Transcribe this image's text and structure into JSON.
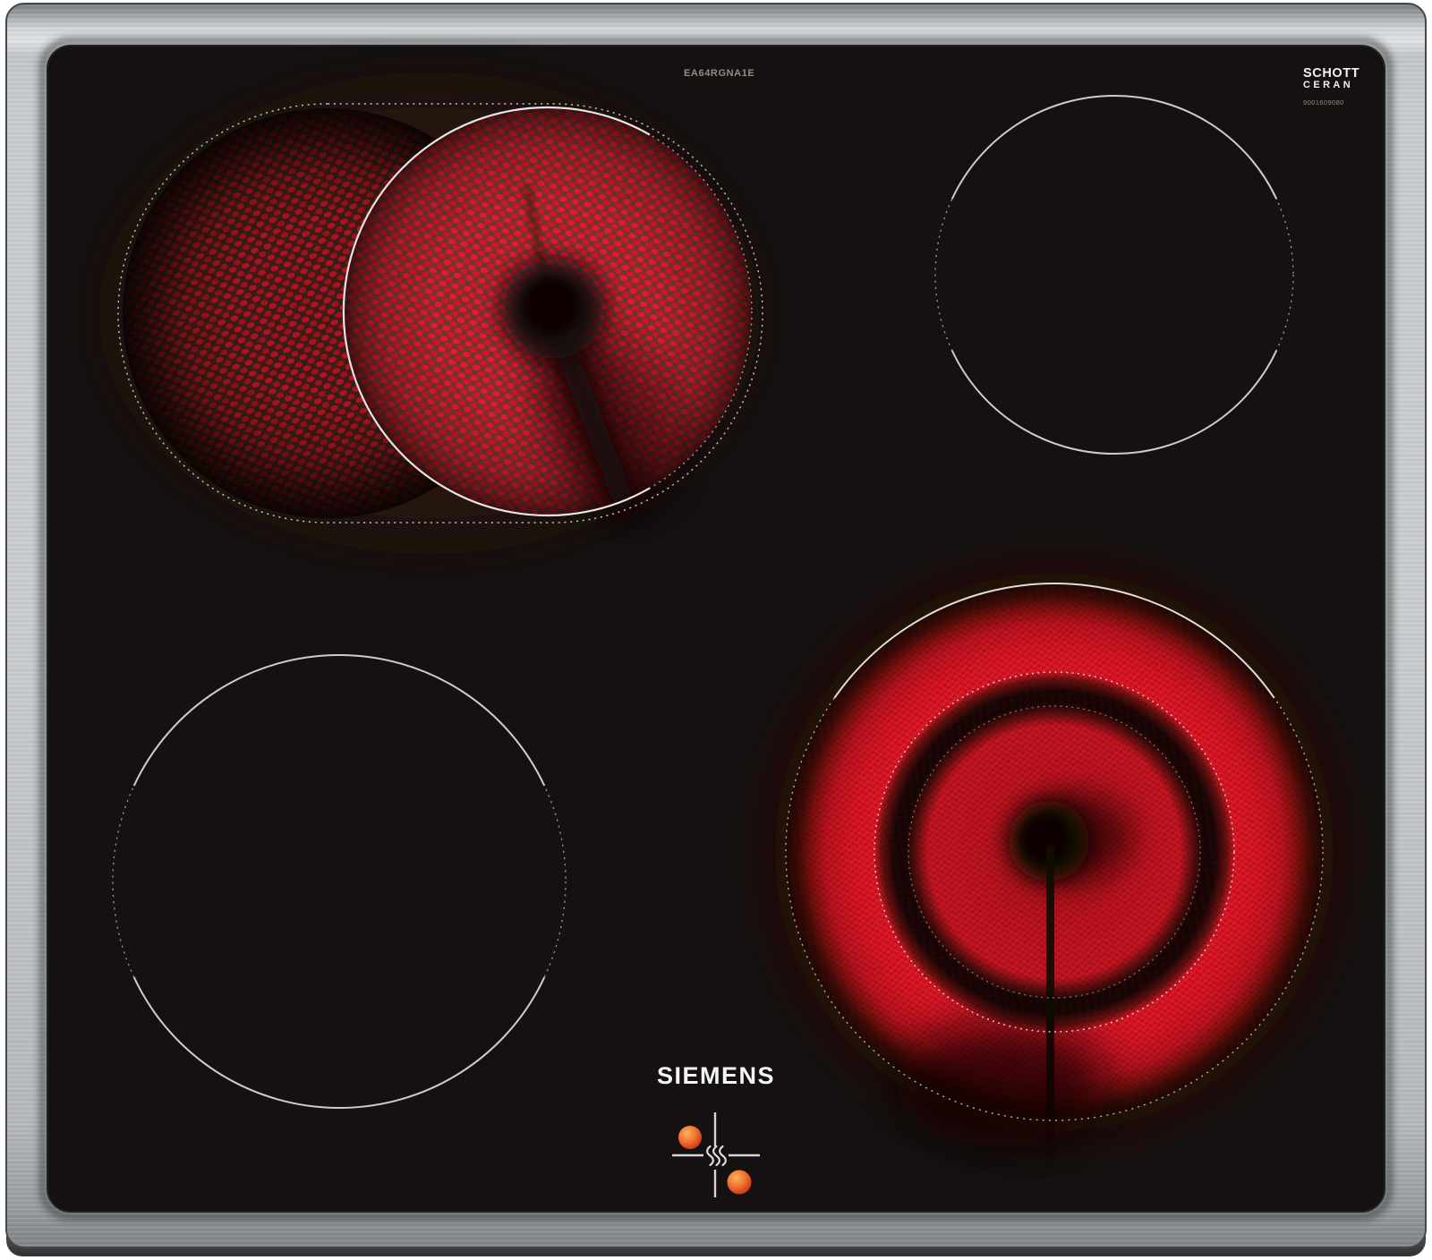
{
  "product": {
    "brand": "SIEMENS",
    "model_number": "EA64RGNA1E",
    "glass_brand_line1": "SCHOTT",
    "glass_brand_line2": "CERAN",
    "serial_number": "9001609080"
  },
  "zones": [
    {
      "position": "back-left",
      "type": "extendable-roaster-zone",
      "state": "on"
    },
    {
      "position": "back-right",
      "type": "single-zone",
      "state": "off"
    },
    {
      "position": "front-left",
      "type": "single-zone",
      "state": "off"
    },
    {
      "position": "front-right",
      "type": "dual-circuit-zone",
      "state": "on"
    }
  ],
  "icons": {
    "residual_heat": "residual-heat-icon",
    "hot_surface_dots": "hot-surface-dot-icon"
  },
  "colors": {
    "glass_black": "#151110",
    "steel_frame": "#c6c9cc",
    "element_red": "#d81522",
    "hot_dot_orange": "#e8662c",
    "marking_white": "#cdcdcd"
  }
}
